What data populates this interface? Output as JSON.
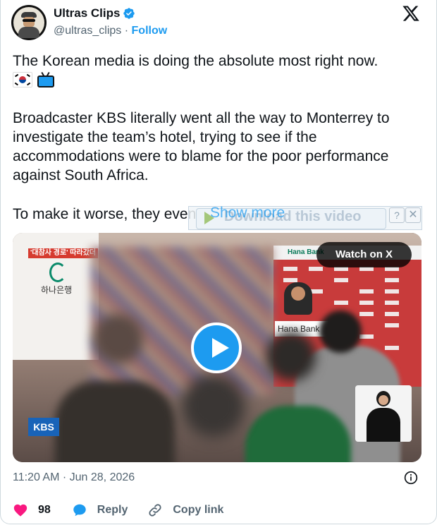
{
  "author": {
    "display_name": "Ultras Clips",
    "handle": "@ultras_clips",
    "separator": "·",
    "follow_label": "Follow"
  },
  "post": {
    "line1": "The Korean media is doing the absolute most right now.",
    "para2": "Broadcaster KBS literally went all the way to Monterrey to investigate the team’s hotel, trying to see if the accommodations were to blame for the poor performance against South Africa.",
    "para3_start": "To make it worse, they even",
    "show_more": "Show more"
  },
  "download_overlay": {
    "label": "Download this video",
    "help": "?",
    "close": "✕"
  },
  "video": {
    "watch_label": "Watch on X",
    "kbs": "KBS",
    "tag_text": "'대참사 경로' 따라갔더",
    "bank_logo_text": "하나은행",
    "hana_bank": "Hana Bank",
    "sponsor_top": "Hana Bank"
  },
  "meta": {
    "timestamp": "11:20 AM · Jun 28, 2026"
  },
  "actions": {
    "likes": "98",
    "reply": "Reply",
    "copy_link": "Copy link"
  },
  "colors": {
    "accent": "#1d9bf0",
    "like": "#f91880",
    "muted": "#536471"
  }
}
